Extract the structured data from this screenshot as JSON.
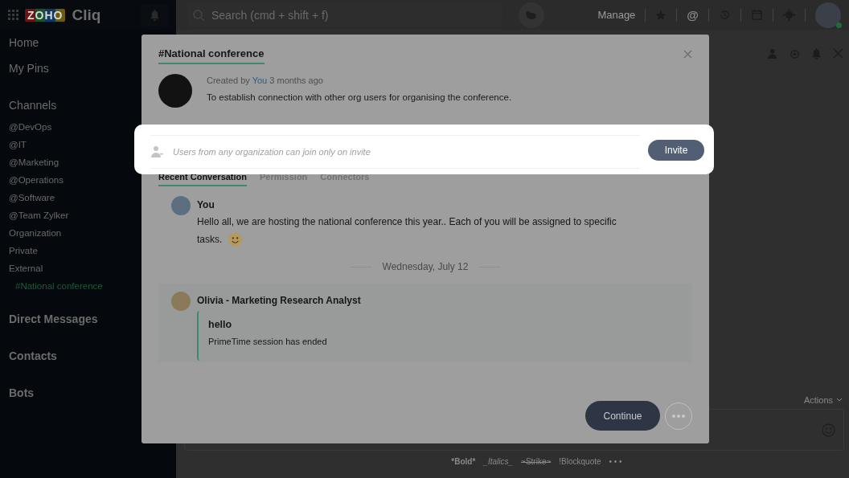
{
  "app": {
    "logo_mark": "ZOHO",
    "logo_text": "Cliq"
  },
  "top_bar": {
    "search": {
      "placeholder": "Search (cmd + shift + f)"
    },
    "manage": "Manage",
    "mentions": "@"
  },
  "sidebar": {
    "sections": [
      {
        "title": "Home"
      },
      {
        "title": "My Pins"
      },
      {
        "title": "Channels",
        "items": [
          {
            "label": "@DevOps",
            "selected": false
          },
          {
            "label": "@IT",
            "selected": false
          },
          {
            "label": "@Marketing",
            "selected": false
          },
          {
            "label": "@Operations",
            "selected": false
          },
          {
            "label": "@Software",
            "selected": false
          },
          {
            "label": "@Team Zylker",
            "selected": false
          },
          {
            "label": "Organization",
            "selected": false
          },
          {
            "label": "Private",
            "selected": false
          },
          {
            "label": "External",
            "selected": false
          },
          {
            "label": "#National conference",
            "selected": true
          }
        ]
      },
      {
        "title": "Direct Messages"
      },
      {
        "title": "Contacts"
      },
      {
        "title": "Bots"
      }
    ]
  },
  "composer": {
    "actions": "Actions",
    "format_hints": [
      {
        "label": "*Bold*",
        "kind": "bold"
      },
      {
        "label": "_Italics_",
        "kind": "italic"
      },
      {
        "label": "~Strike~",
        "kind": "strike"
      },
      {
        "label": "!Blockquote",
        "kind": "plain"
      },
      {
        "label": "• • •",
        "kind": "plain"
      }
    ]
  },
  "dialog": {
    "title": "#National conference",
    "created_prefix": "Created by",
    "created_by": "You",
    "created_suffix": "3 months ago",
    "description": "To establish connection with other org users for organising the conference.",
    "invite": {
      "placeholder": "Users from any organization can join only on invite",
      "button": "Invite"
    },
    "tabs": [
      {
        "label": "Recent Conversation",
        "selected": true
      },
      {
        "label": "Permission",
        "selected": false
      },
      {
        "label": "Connectors",
        "selected": false
      }
    ],
    "messages": [
      {
        "kind": "text",
        "sender": "You",
        "text": "Hello all, we are hosting the national conference this year.. Each of you will be assigned to specific tasks."
      },
      {
        "kind": "date",
        "text": "Wednesday, July 12"
      },
      {
        "kind": "card",
        "sender": "Olivia - Marketing Research  Analyst",
        "card_title": "hello",
        "card_text": "PrimeTime session has ended"
      }
    ],
    "continue": "Continue"
  }
}
